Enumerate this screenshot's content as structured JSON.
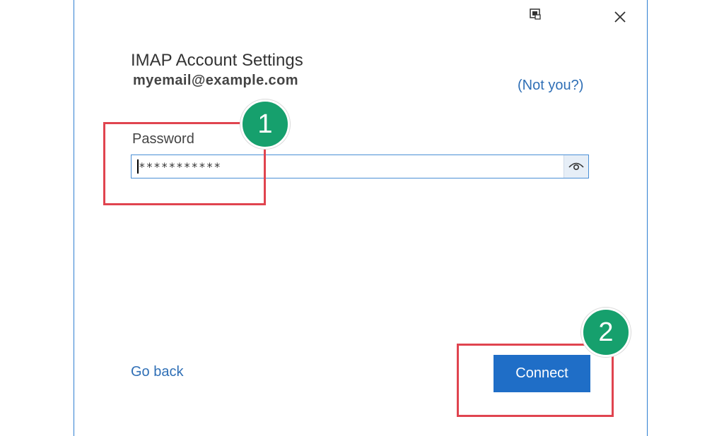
{
  "dialog": {
    "heading": "IMAP Account Settings",
    "email": "myemail@example.com",
    "not_you": "(Not you?)",
    "password": {
      "label": "Password",
      "value": "***********"
    },
    "go_back": "Go back",
    "connect": "Connect"
  },
  "annotations": {
    "step1": "1",
    "step2": "2"
  },
  "icons": [
    "window-icon",
    "close-icon",
    "eye-icon"
  ],
  "colors": {
    "accent": "#1f6ec7",
    "link": "#2f6fb6",
    "highlight": "#e0444f",
    "badge": "#16a06d"
  }
}
